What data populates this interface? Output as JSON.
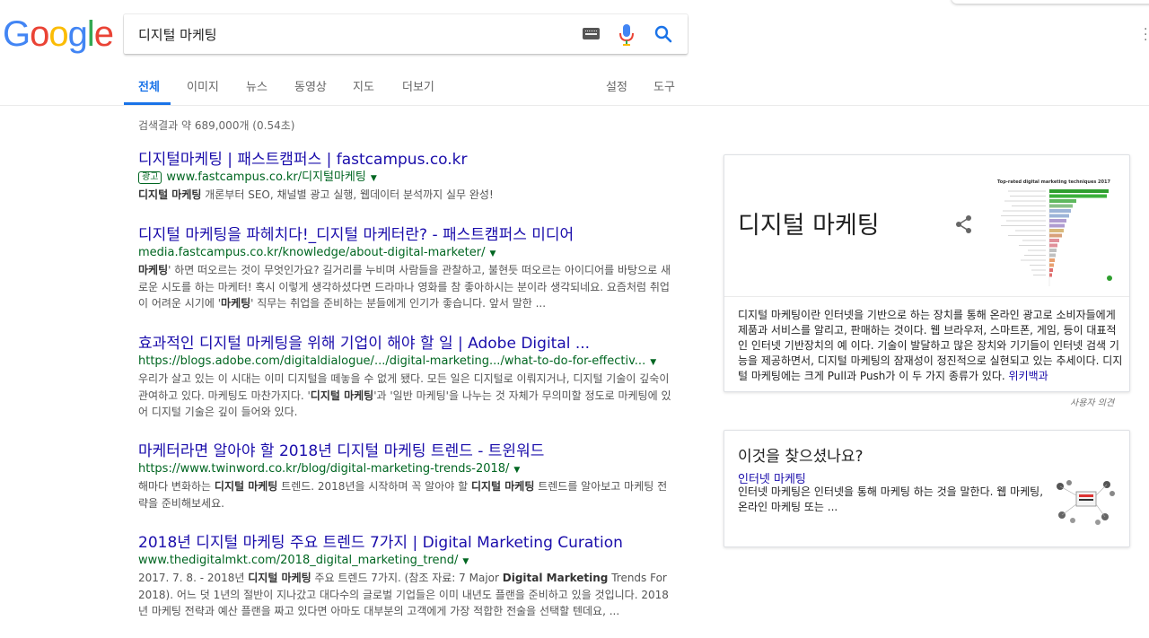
{
  "logo": {
    "letters": [
      "G",
      "o",
      "o",
      "g",
      "l",
      "e"
    ],
    "colors": [
      "#4285F4",
      "#EA4335",
      "#FBBC05",
      "#4285F4",
      "#34A853",
      "#EA4335"
    ]
  },
  "search": {
    "query": "디지털 마케팅"
  },
  "tabs": {
    "all": "전체",
    "images": "이미지",
    "news": "뉴스",
    "videos": "동영상",
    "maps": "지도",
    "more": "더보기",
    "settings": "설정",
    "tools": "도구"
  },
  "stats": "검색결과 약 689,000개 (0.54초)",
  "results": [
    {
      "title": "디지털마케팅 | 패스트캠퍼스 | fastcampus.co.kr",
      "ad": "광고",
      "url": "www.fastcampus.co.kr/디지털마케팅",
      "snippet_b": "디지털 마케팅",
      "snippet": " 개론부터 SEO, 채널별 광고 실행, 웹데이터 분석까지 실무 완성!"
    },
    {
      "title": "디지털 마케팅을 파헤치다!_디지털 마케터란? - 패스트캠퍼스 미디어",
      "url": "media.fastcampus.co.kr/knowledge/about-digital-marketer/",
      "snippet_b1": "마케팅",
      "snippet_1": "' 하면 떠오르는 것이 무엇인가요? 길거리를 누비며 사람들을 관찰하고, 불현듯 떠오르는 아이디어를 바탕으로 새로운 시도를 하는 마케터! 혹시 이렇게 생각하셨다면 드라마나 영화를 참 좋아하시는 분이라 생각되네요. 요즘처럼 취업이 어려운 시기에 '",
      "snippet_b2": "마케팅",
      "snippet_2": "' 직무는 취업을 준비하는 분들에게 인기가 좋습니다. 앞서 말한 ..."
    },
    {
      "title": "효과적인 디지털 마케팅을 위해 기업이 해야 할 일 | Adobe Digital ...",
      "url": "https://blogs.adobe.com/digitaldialogue/.../digital-marketing.../what-to-do-for-effectiv...",
      "snippet_1": "우리가 살고 있는 이 시대는 이미 디지털을 떼놓을 수 없게 됐다. 모든 일은 디지털로 이뤄지거나, 디지털 기술이 깊숙이 관여하고 있다. 마케팅도 마찬가지다. '",
      "snippet_b1": "디지털 마케팅",
      "snippet_2": "'과 '일반 마케팅'을 나누는 것 자체가 무의미할 정도로 마케팅에 있어 디지털 기술은 깊이 들어와 있다."
    },
    {
      "title": "마케터라면 알아야 할 2018년 디지털 마케팅 트렌드 - 트윈워드",
      "url": "https://www.twinword.co.kr/blog/digital-marketing-trends-2018/",
      "snippet_1": "해마다 변화하는 ",
      "snippet_b1": "디지털 마케팅",
      "snippet_2": " 트렌드. 2018년을 시작하며 꼭 알아야 할 ",
      "snippet_b2": "디지털 마케팅",
      "snippet_3": " 트렌드를 알아보고 마케팅 전략을 준비해보세요."
    },
    {
      "title": "2018년 디지털 마케팅 주요 트렌드 7가지 | Digital Marketing Curation",
      "url": "www.thedigitalmkt.com/2018_digital_marketing_trend/",
      "snippet_1": "2017. 7. 8. - 2018년 ",
      "snippet_b1": "디지털 마케팅",
      "snippet_2": " 주요 트렌드 7가지. (참조 자료: 7 Major ",
      "snippet_b2": "Digital Marketing",
      "snippet_3": " Trends For 2018). 어느 덧 1년의 절반이 지나갔고 대다수의 글로벌 기업들은 이미 내년도 플랜을 준비하고 있을 것입니다. 2018년 마케팅 전략과 예산 플랜을 짜고 있다면 아마도 대부분의 고객에게 가장 적합한 전술을 선택할 텐데요, ..."
    }
  ],
  "knowledge_panel": {
    "title": "디지털 마케팅",
    "thumb_title": "Top-rated digital marketing techniques 2017",
    "description": "디지털 마케팅이란 인터넷을 기반으로 하는 장치를 통해 온라인 광고로 소비자들에게 제품과 서비스를 알리고, 판매하는 것이다. 웹 브라우저, 스마트폰, 게임, 등이 대표적인 인터넷 기반장치의 예 이다. 기술이 발달하고 많은 장치와 기기들이 인터넷 검색 기능을 제공하면서, 디지털 마케팅의 잠재성이 정진적으로 실현되고 있는 추세이다. 디지털 마케팅에는 크게 Pull과 Push가 이 두 가지 종류가 있다. ",
    "source_link": "위키백과",
    "feedback": "사용자 의견"
  },
  "did_you_mean": {
    "title": "이것을 찾으셨나요?",
    "link": "인터넷 마케팅",
    "text": "인터넷 마케팅은 인터넷을 통해 마케팅 하는 것을 말한다. 웹 마케팅, 온라인 마케팅 또는 ..."
  },
  "colors": {
    "link": "#1a0dab",
    "url": "#006621",
    "accent": "#1a73e8"
  }
}
